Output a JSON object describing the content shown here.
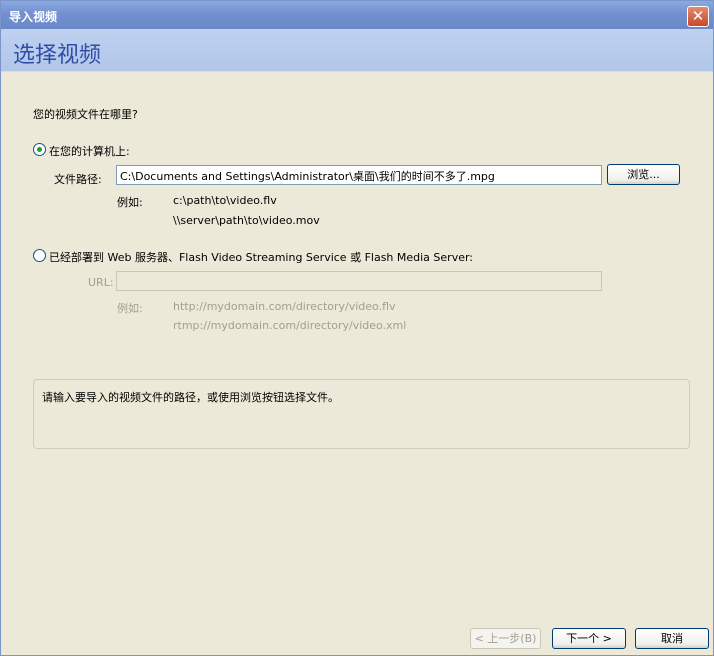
{
  "window": {
    "title": "导入视频",
    "close_glyph": "✕"
  },
  "header": {
    "title": "选择视频"
  },
  "question": "您的视频文件在哪里?",
  "local_option": {
    "label": "在您的计算机上:",
    "selected": true,
    "path_label": "文件路径:",
    "path_value": "C:\\Documents and Settings\\Administrator\\桌面\\我们的时间不多了.mpg",
    "browse_label": "浏览...",
    "example_label": "例如:",
    "examples": [
      "c:\\path\\to\\video.flv",
      "\\\\server\\path\\to\\video.mov"
    ]
  },
  "web_option": {
    "label": "已经部署到 Web 服务器、Flash Video Streaming Service 或 Flash Media Server:",
    "selected": false,
    "url_label": "URL:",
    "url_value": "",
    "example_label": "例如:",
    "examples": [
      "http://mydomain.com/directory/video.flv",
      "rtmp://mydomain.com/directory/video.xml"
    ]
  },
  "info_message": "请输入要导入的视频文件的路径，或使用浏览按钮选择文件。",
  "buttons": {
    "back": "< 上一步(B)",
    "next": "下一个 >",
    "cancel": "取消"
  },
  "colors": {
    "title_bar": "#7290d0",
    "header_band": "#b1c6ea",
    "header_text": "#2e4ea8",
    "radio_dot": "#21a121"
  }
}
